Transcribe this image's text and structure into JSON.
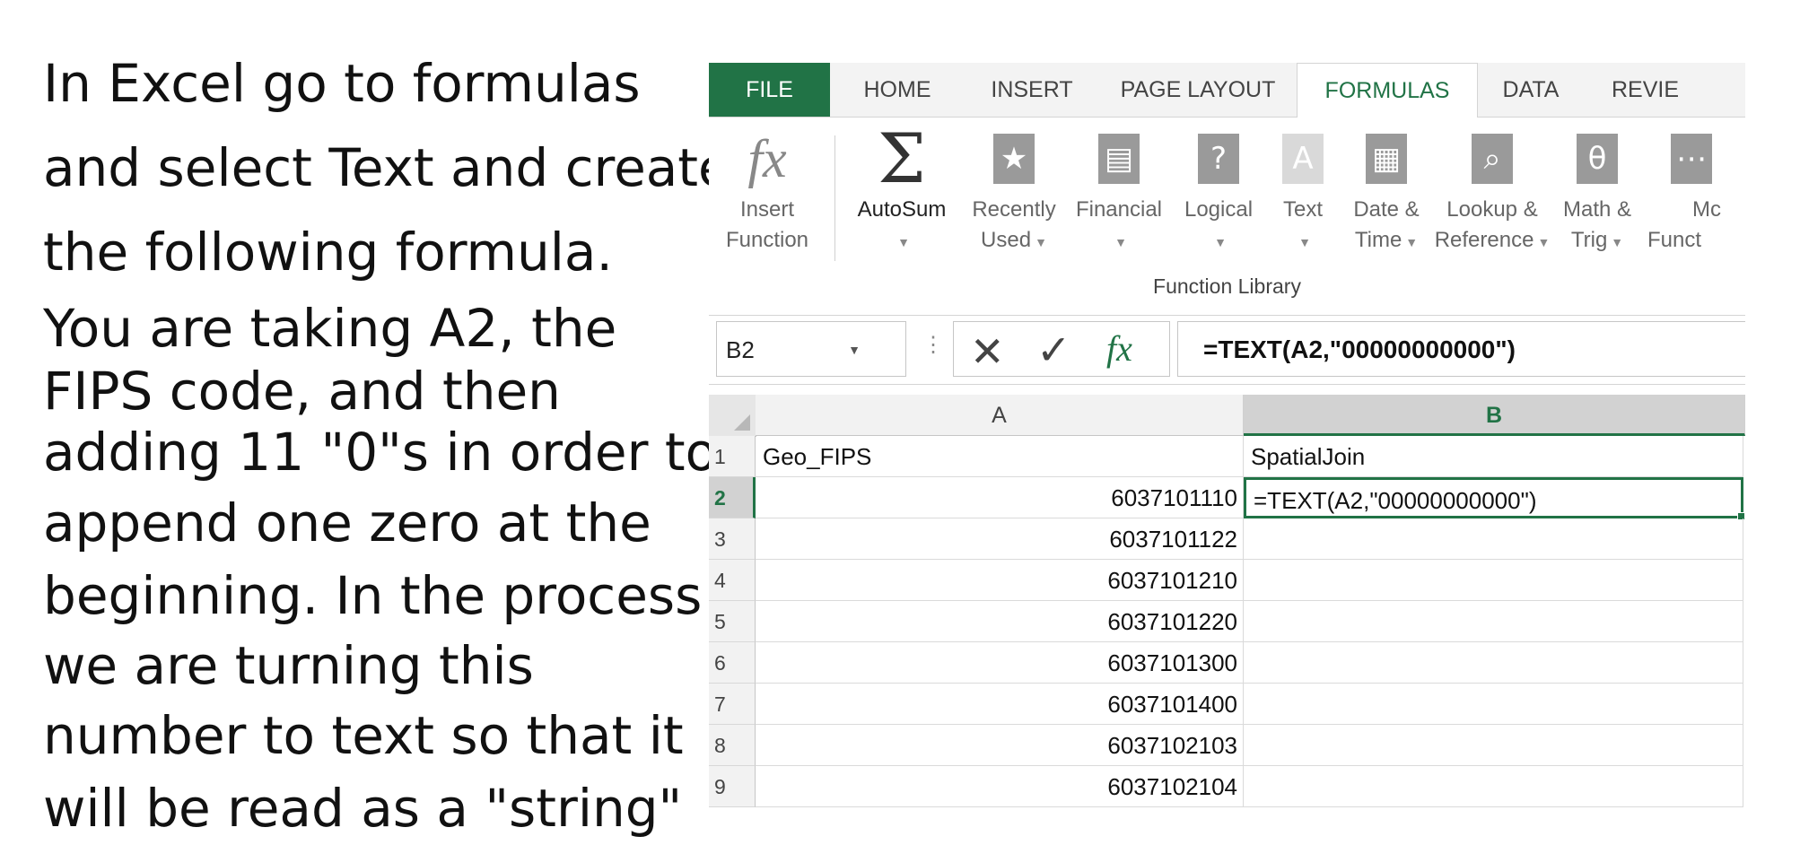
{
  "instructions": {
    "lines": [
      "In Excel go to formulas",
      "and select Text and create",
      "the following formula.",
      "You are taking A2, the",
      "FIPS code, and then",
      "adding 11 \"0\"s in order to",
      "append one zero at the",
      "beginning. In the process",
      "we are turning this",
      "number to text so that it",
      "will be read as a \"string\""
    ]
  },
  "ribbon": {
    "tabs": [
      "FILE",
      "HOME",
      "INSERT",
      "PAGE LAYOUT",
      "FORMULAS",
      "DATA",
      "REVIE"
    ],
    "active_tab": "FORMULAS",
    "buttons": [
      {
        "icon": "insert-function-icon",
        "line1": "Insert",
        "line2": "Function"
      },
      {
        "icon": "autosum-icon",
        "line1": "AutoSum",
        "line2": ""
      },
      {
        "icon": "recently-used-icon",
        "line1": "Recently",
        "line2": "Used"
      },
      {
        "icon": "financial-icon",
        "line1": "Financial",
        "line2": ""
      },
      {
        "icon": "logical-icon",
        "line1": "Logical",
        "line2": ""
      },
      {
        "icon": "text-icon",
        "line1": "Text",
        "line2": ""
      },
      {
        "icon": "date-time-icon",
        "line1": "Date &",
        "line2": "Time"
      },
      {
        "icon": "lookup-reference-icon",
        "line1": "Lookup &",
        "line2": "Reference"
      },
      {
        "icon": "math-trig-icon",
        "line1": "Math &",
        "line2": "Trig"
      },
      {
        "icon": "more-functions-icon",
        "line1": "Mc",
        "line2": "Funct"
      }
    ],
    "group_label": "Function Library"
  },
  "formula_bar": {
    "name_box": "B2",
    "formula": "=TEXT(A2,\"00000000000\")"
  },
  "sheet": {
    "columns": [
      "A",
      "B"
    ],
    "selected_column": "B",
    "selected_row": "2",
    "rows": [
      {
        "num": "1",
        "a": "Geo_FIPS",
        "b": "SpatialJoin"
      },
      {
        "num": "2",
        "a": "6037101110",
        "b": "=TEXT(A2,\"00000000000\")"
      },
      {
        "num": "3",
        "a": "6037101122",
        "b": ""
      },
      {
        "num": "4",
        "a": "6037101210",
        "b": ""
      },
      {
        "num": "5",
        "a": "6037101220",
        "b": ""
      },
      {
        "num": "6",
        "a": "6037101300",
        "b": ""
      },
      {
        "num": "7",
        "a": "6037101400",
        "b": ""
      },
      {
        "num": "8",
        "a": "6037102103",
        "b": ""
      },
      {
        "num": "9",
        "a": "6037102104",
        "b": ""
      }
    ]
  },
  "colors": {
    "accent": "#217346",
    "header_bg": "#f2f2f2"
  }
}
